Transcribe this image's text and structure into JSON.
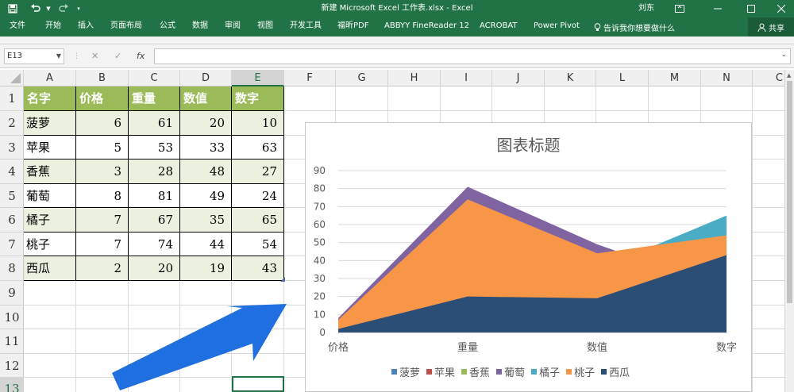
{
  "titlebar": {
    "document_title": "新建 Microsoft Excel 工作表.xlsx  -  Excel",
    "user_name": "刘东"
  },
  "ribbon": {
    "tabs": [
      "文件",
      "开始",
      "插入",
      "页面布局",
      "公式",
      "数据",
      "审阅",
      "视图",
      "开发工具",
      "福昕PDF",
      "ABBYY FineReader 12",
      "ACROBAT",
      "Power Pivot"
    ],
    "tell_me": "告诉我你想要做什么",
    "share": "共享"
  },
  "formula_bar": {
    "name_box": "E13",
    "fx_label": "fx",
    "formula": ""
  },
  "columns": [
    "A",
    "B",
    "C",
    "D",
    "E",
    "F",
    "G",
    "H",
    "I",
    "J",
    "K",
    "L",
    "M",
    "N",
    "C"
  ],
  "rows": [
    "1",
    "2",
    "3",
    "4",
    "5",
    "6",
    "7",
    "8",
    "9",
    "10",
    "11",
    "12",
    "13"
  ],
  "table": {
    "headers": [
      "名字",
      "价格",
      "重量",
      "数值",
      "数字"
    ],
    "rows": [
      [
        "菠萝",
        "6",
        "61",
        "20",
        "10"
      ],
      [
        "苹果",
        "5",
        "53",
        "33",
        "63"
      ],
      [
        "香蕉",
        "3",
        "28",
        "48",
        "27"
      ],
      [
        "葡萄",
        "8",
        "81",
        "49",
        "24"
      ],
      [
        "橘子",
        "7",
        "67",
        "35",
        "65"
      ],
      [
        "桃子",
        "7",
        "74",
        "44",
        "54"
      ],
      [
        "西瓜",
        "2",
        "20",
        "19",
        "43"
      ]
    ]
  },
  "colors": {
    "excel_green": "#217346",
    "header_fill": "#9bbb59",
    "band_fill": "#ebf1de",
    "arrow": "#1f6fe0"
  },
  "chart_data": {
    "type": "area",
    "title": "图表标题",
    "categories": [
      "价格",
      "重量",
      "数值",
      "数字"
    ],
    "ylim": [
      0,
      90
    ],
    "yticks": [
      "0",
      "10",
      "20",
      "30",
      "40",
      "50",
      "60",
      "70",
      "80",
      "90"
    ],
    "grid": true,
    "legend_position": "bottom",
    "series": [
      {
        "name": "菠萝",
        "values": [
          6,
          61,
          20,
          10
        ],
        "color": "#4f81bd"
      },
      {
        "name": "苹果",
        "values": [
          5,
          53,
          33,
          63
        ],
        "color": "#c0504d"
      },
      {
        "name": "香蕉",
        "values": [
          3,
          28,
          48,
          27
        ],
        "color": "#9bbb59"
      },
      {
        "name": "葡萄",
        "values": [
          8,
          81,
          49,
          24
        ],
        "color": "#8064a2"
      },
      {
        "name": "橘子",
        "values": [
          7,
          67,
          35,
          65
        ],
        "color": "#4bacc6"
      },
      {
        "name": "桃子",
        "values": [
          7,
          74,
          44,
          54
        ],
        "color": "#f79646"
      },
      {
        "name": "西瓜",
        "values": [
          2,
          20,
          19,
          43
        ],
        "color": "#2c4d75"
      }
    ]
  }
}
